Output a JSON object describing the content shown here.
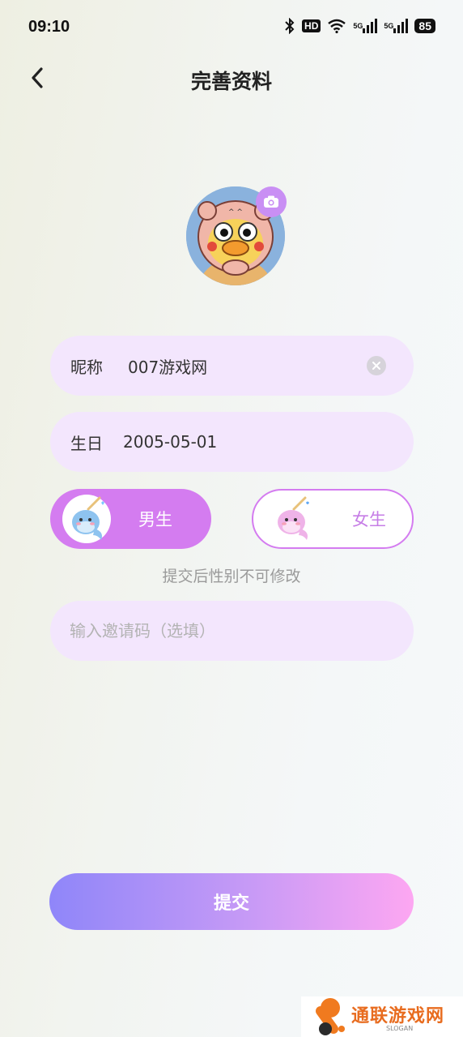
{
  "status_bar": {
    "time": "09:10",
    "hd_label": "HD",
    "network_1": "5G",
    "network_2": "5G",
    "battery": "85"
  },
  "header": {
    "title": "完善资料"
  },
  "profile": {
    "nickname_label": "昵称",
    "nickname_value": "007游戏网",
    "birthday_label": "生日",
    "birthday_value": "2005-05-01"
  },
  "gender": {
    "male_label": "男生",
    "female_label": "女生",
    "selected": "male",
    "hint": "提交后性别不可修改"
  },
  "invite": {
    "placeholder": "输入邀请码（选填）",
    "value": ""
  },
  "submit": {
    "label": "提交"
  },
  "watermark": {
    "text": "通联游戏网",
    "slogan": "SLOGAN"
  },
  "colors": {
    "accent": "#d47cf0",
    "field_bg": "#f3e6fd",
    "submit_gradient_start": "#8f86f9",
    "submit_gradient_end": "#fda7f2"
  }
}
